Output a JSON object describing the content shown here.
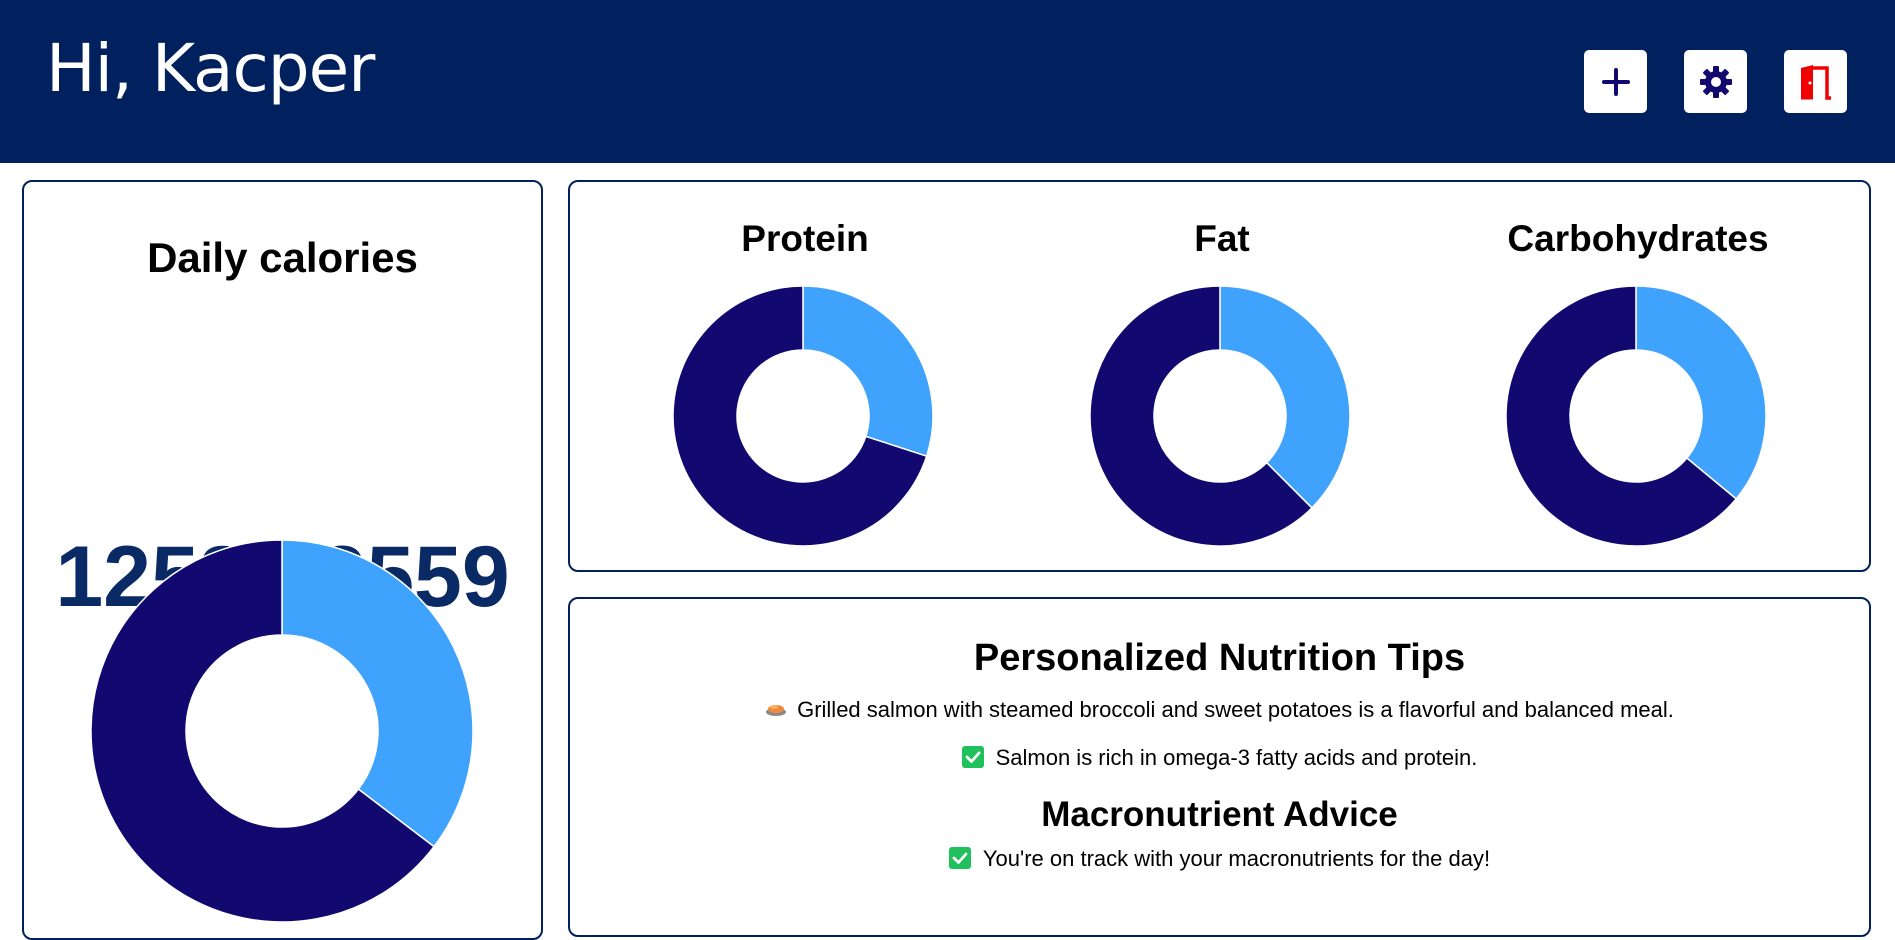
{
  "header": {
    "greeting": "Hi, Kacper",
    "icons": [
      "plus-icon",
      "gear-icon",
      "door-icon"
    ]
  },
  "calories": {
    "title": "Daily calories",
    "consumed": "1258",
    "separator": "/",
    "goal": "3559"
  },
  "macros": [
    {
      "label": "Protein"
    },
    {
      "label": "Fat"
    },
    {
      "label": "Carbohydrates"
    }
  ],
  "tips": {
    "title": "Personalized Nutrition Tips",
    "lines": [
      "Grilled salmon with steamed broccoli and sweet potatoes is a flavorful and balanced meal.",
      "Salmon is rich in omega-3 fatty acids and protein."
    ],
    "advice_title": "Macronutrient Advice",
    "advice_line": "You're on track with your macronutrients for the day!"
  },
  "colors": {
    "header_bg": "#00215e",
    "consumed": "#3fa2fc",
    "remaining": "#110870",
    "calorie_text": "#0a2a66",
    "check": "#20c05c",
    "logout": "#f00000"
  },
  "chart_data": [
    {
      "type": "pie",
      "title": "Daily calories",
      "values": [
        1258,
        2301
      ]
    },
    {
      "type": "pie",
      "title": "Protein",
      "values": [
        0.3,
        0.7
      ]
    },
    {
      "type": "pie",
      "title": "Fat",
      "values": [
        0.375,
        0.625
      ]
    },
    {
      "type": "pie",
      "title": "Carbohydrates",
      "values": [
        0.36,
        0.64
      ]
    }
  ]
}
